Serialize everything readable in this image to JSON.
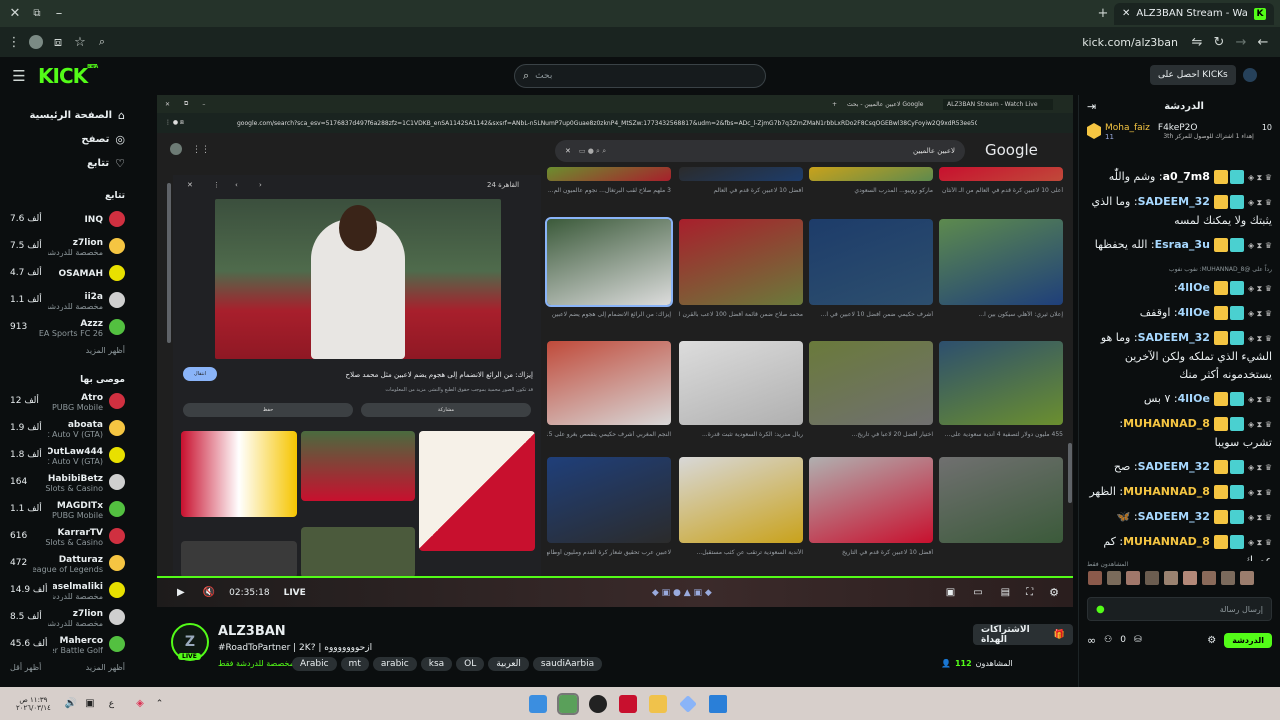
{
  "browser": {
    "tab_title": "ALZ3BAN Stream - Watch Live",
    "url": "kick.com/alz3ban"
  },
  "header": {
    "search_placeholder": "بحث",
    "kicks_label": "احصل على KICKs"
  },
  "sidebar": {
    "nav": [
      {
        "label": "الصفحة الرئيسية",
        "icon": "home-icon"
      },
      {
        "label": "تصفح",
        "icon": "browse-icon"
      },
      {
        "label": "تتابع",
        "icon": "heart-icon"
      }
    ],
    "following_title": "تتابع",
    "following": [
      {
        "name": "INQ",
        "game": "",
        "count": "7.6 ألف"
      },
      {
        "name": "z7lion",
        "game": "مخصصة للدردشة فقط",
        "count": "7.5 ألف"
      },
      {
        "name": "OSAMAH",
        "game": "",
        "count": "4.7 ألف"
      },
      {
        "name": "ii2a",
        "game": "مخصصة للدردشة فقط",
        "count": "1.1 ألف"
      },
      {
        "name": "Azzz",
        "game": "EA Sports FC 26",
        "count": "913"
      }
    ],
    "show_more": "أظهر المزيد",
    "recommended_title": "موصى بها",
    "recommended": [
      {
        "name": "Atro",
        "game": "PUBG Mobile",
        "count": "12 ألف"
      },
      {
        "name": "aboata",
        "game": "Grand Theft Auto V (GTA)",
        "count": "1.9 ألف"
      },
      {
        "name": "OutLaw444",
        "game": "Grand Theft Auto V (GTA)",
        "count": "1.8 ألف"
      },
      {
        "name": "HabibiBetz",
        "game": "Slots & Casino",
        "count": "164"
      },
      {
        "name": "MAGDITx",
        "game": "PUBG Mobile",
        "count": "1.1 ألف"
      },
      {
        "name": "KarrarTV",
        "game": "Slots & Casino",
        "count": "616"
      },
      {
        "name": "Datturaz",
        "game": "League of Legends",
        "count": "472"
      },
      {
        "name": "ilyaselmaliki",
        "game": "مخصصة للدردشة فقط",
        "count": "14.9 ألف"
      },
      {
        "name": "z7lion",
        "game": "مخصصة للدردشة فقط",
        "count": "8.5 ألف"
      },
      {
        "name": "Maherco",
        "game": "Super Battle Golf",
        "count": "45.6 ألف"
      }
    ],
    "show_more_2": "أظهر المزيد",
    "show_less": "أظهر أقل"
  },
  "stream": {
    "inner_tab1": "لاعبين عالميين - بحث Google",
    "inner_tab2": "ALZ3BAN Stream - Watch Live",
    "inner_url": "google.com/search?sca_esv=5176837d497f6a288zfz=1C1VDKB_enSA1142SA1142&sxsrf=ANbL-n5LNumP7up0Guae8z0zknP4_MtSZw:1773432568817&udm=2&fbs=ADc_l-ZjmG7b7q3ZmZMaN1rbbLxRDo2F8CsqOGEBwl38CyFoyiw2Q9xdR53ee5Gx9tGg...",
    "google_query": "لاعبين عالميين",
    "google_logo": "Google",
    "preview_source": "القاهرة 24",
    "preview_title": "إيزاك: من الرائع الانضمام إلى هجوم يضم لاعبين مثل محمد صلاح",
    "preview_sub": "قد تكون الصور محمية بموجب حقوق الطبع والنشر. مزيد من المعلومات",
    "visit_btn": "انتقال",
    "share_btn": "مشاركة",
    "save_btn": "حفظ",
    "time": "02:35:18",
    "live": "LIVE",
    "captions": [
      "3 ملهم صلاح لقب البرتغال... نجوم عالميون الم...",
      "أفضل 10 لاعبين كرة قدم في العالم",
      "ماركو روبيو... المدرب السعودي",
      "أعلى 10 لاعبين كرة قدم في العالم من الـ الأنثان",
      "إيزاك: من الرائع الانضمام إلى هجوم يضم لاعبين",
      "محمد صلاح ضمن قائمة أفضل 100 لاعب بالقرن الـ 21",
      "أشرف حكيمي ضمن أفضل 10 لاعبين في ا...",
      "إعلان ثيري: الأهلي سيكون بين ا...",
      "النجم المغربي أشرف حكيمي يتقمص بغرو على 15...",
      "ريال مدريد: الكرة السعودية تثبت قدرة...",
      "اختيار أفضل 20 لاعبا في تاريخ...",
      "455 مليون دولار لتصفية 4 أندية سعودية على...",
      "لاعبين عرب تحقيق شعار كرة القدم ومليون أوطانهم ملتقة من ذهب",
      "الأندية السعودية ترتقب عن كثب مستقبل...",
      "أفضل 10 لاعبين كرة قدم في التاريخ"
    ]
  },
  "channel": {
    "name": "ALZ3BAN",
    "live_badge": "LIVE",
    "title": "#RoadToPartner | 2K? | ازحوووووووه",
    "category": "مخصصة للدردشة فقط",
    "tags": [
      "Arabic",
      "mt",
      "arabic",
      "ksa",
      "OL",
      "العربية",
      "saudiAarbia"
    ],
    "viewers_label": "المشاهدون",
    "viewers": "112",
    "subs_button": "الاشتراكات الهداة"
  },
  "chat": {
    "title": "الدردشة",
    "top_gifters": [
      {
        "name": "Moha_faiz",
        "count": "11"
      },
      {
        "name": "F4keP2O",
        "count": "10",
        "note": "إهداء 1 اشتراك للوصول للمركز 3th"
      }
    ],
    "messages": [
      {
        "user": "a0_7m8",
        "color": "#ffffff",
        "text": "وشم واللّٰه"
      },
      {
        "user": "SADEEM_32",
        "color": "#a7d8ff",
        "text": "وما الذي يثبتك ولا يمكنك لمسه"
      },
      {
        "user": "Esraa_3u",
        "color": "#a7d8ff",
        "text": "الله يحفظها"
      },
      {
        "user": "4lIOe",
        "color": "#a7d8ff",
        "text": "",
        "reply": "رداً على @MUHANNAD_8: نفوب نفوب"
      },
      {
        "user": "4lIOe",
        "color": "#a7d8ff",
        "text": "اوقفف"
      },
      {
        "user": "SADEEM_32",
        "color": "#a7d8ff",
        "text": "وما هو الشيء الذي تملكه ولكن الآخرين يستخدمونه أكثر منك"
      },
      {
        "user": "4lIOe",
        "color": "#a7d8ff",
        "text": "٧ بس"
      },
      {
        "user": "MUHANNAD_8",
        "color": "#f5c542",
        "text": "تشرب سويبا"
      },
      {
        "user": "SADEEM_32",
        "color": "#a7d8ff",
        "text": "صح"
      },
      {
        "user": "MUHANNAD_8",
        "color": "#f5c542",
        "text": "الظهر"
      },
      {
        "user": "SADEEM_32",
        "color": "#a7d8ff",
        "text": "🦋"
      },
      {
        "user": "MUHANNAD_8",
        "color": "#f5c542",
        "text": "كم عمرك"
      }
    ],
    "viewers_only": "المشاهدون فقط",
    "input_placeholder": "إرسال رسالة",
    "send_label": "الدردشة",
    "points": "0"
  },
  "taskbar": {
    "time": "١١:٣٩ ص",
    "date": "٢٠٢٦/٠٣/١٤",
    "lang": "ع"
  }
}
